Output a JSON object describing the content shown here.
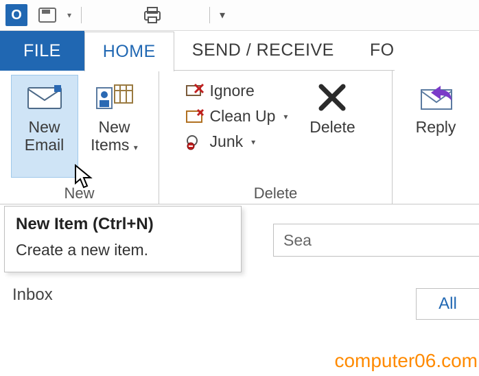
{
  "qat": {
    "app_letter": "O"
  },
  "tabs": {
    "file": "FILE",
    "home": "HOME",
    "send_receive": "SEND / RECEIVE",
    "folder_partial": "FO"
  },
  "ribbon": {
    "new_group": {
      "label": "New",
      "new_email_line1": "New",
      "new_email_line2": "Email",
      "new_items_line1": "New",
      "new_items_line2": "Items"
    },
    "delete_group": {
      "label": "Delete",
      "ignore": "Ignore",
      "clean_up": "Clean Up",
      "junk": "Junk",
      "delete": "Delete"
    },
    "respond_group": {
      "reply": "Reply"
    }
  },
  "tooltip": {
    "title": "New Item (Ctrl+N)",
    "body": "Create a new item."
  },
  "nav": {
    "inbox": "Inbox"
  },
  "search": {
    "placeholder_partial": "Sea"
  },
  "filter": {
    "all": "All"
  },
  "watermark": "computer06.com"
}
